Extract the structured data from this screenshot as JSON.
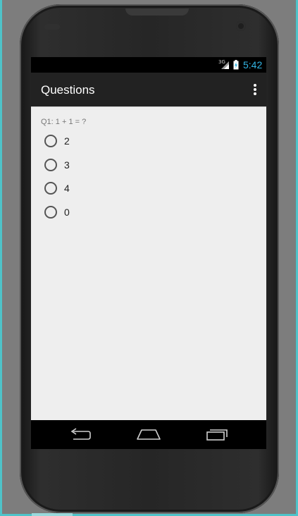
{
  "status_bar": {
    "network_type": "3G",
    "time": "5:42",
    "clock_color": "#33b5e5",
    "signal_icon": "signal-icon",
    "battery_icon": "battery-charging-icon"
  },
  "action_bar": {
    "title": "Questions",
    "overflow_icon": "overflow-menu-icon"
  },
  "question": {
    "label": "Q1: 1 + 1 = ?",
    "options": [
      {
        "label": "2"
      },
      {
        "label": "3"
      },
      {
        "label": "4"
      },
      {
        "label": "0"
      }
    ]
  },
  "nav_bar": {
    "back_icon": "back-icon",
    "home_icon": "home-icon",
    "recents_icon": "recent-apps-icon"
  }
}
